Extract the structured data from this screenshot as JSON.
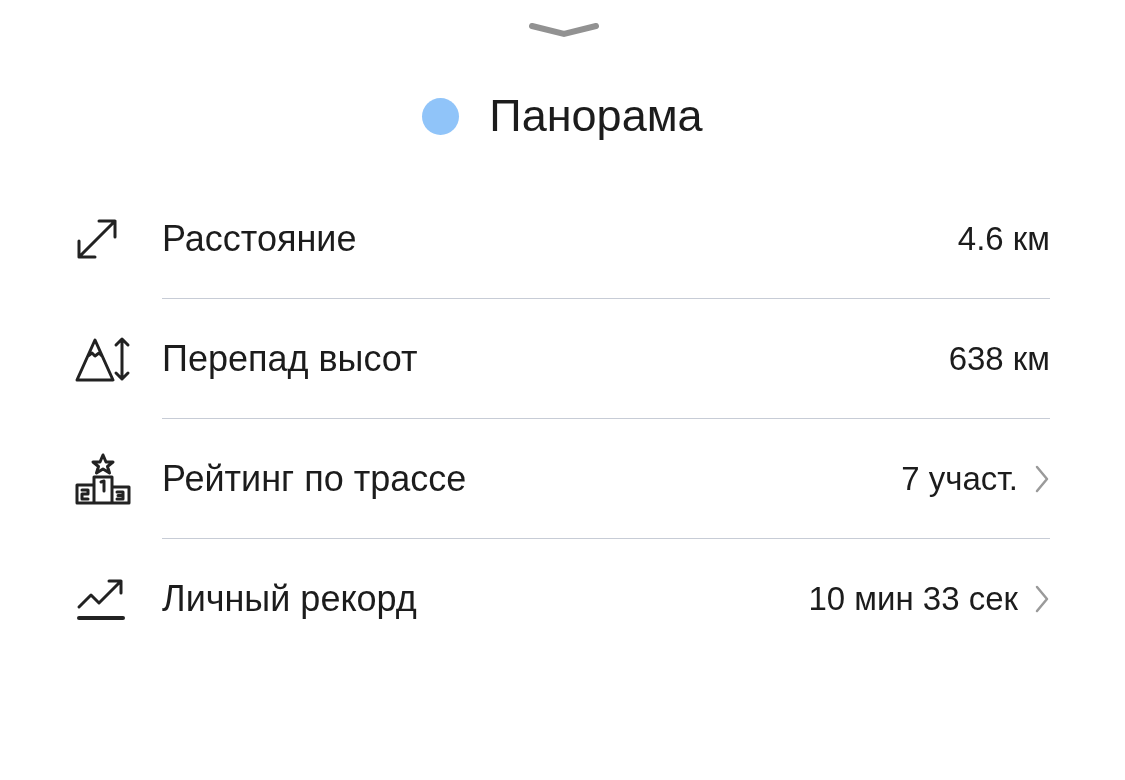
{
  "header": {
    "title": "Панорама",
    "color": "#90c4f9"
  },
  "stats": [
    {
      "kind": "distance",
      "label": "Расстояние",
      "value": "4.6 км",
      "chevron": false
    },
    {
      "kind": "elevation",
      "label": "Перепад высот",
      "value": "638 км",
      "chevron": false
    },
    {
      "kind": "podium",
      "label": "Рейтинг по трассе",
      "value": "7 участ.",
      "chevron": true
    },
    {
      "kind": "trend",
      "label": "Личный рекорд",
      "value": "10 мин 33 сек",
      "chevron": true
    }
  ]
}
